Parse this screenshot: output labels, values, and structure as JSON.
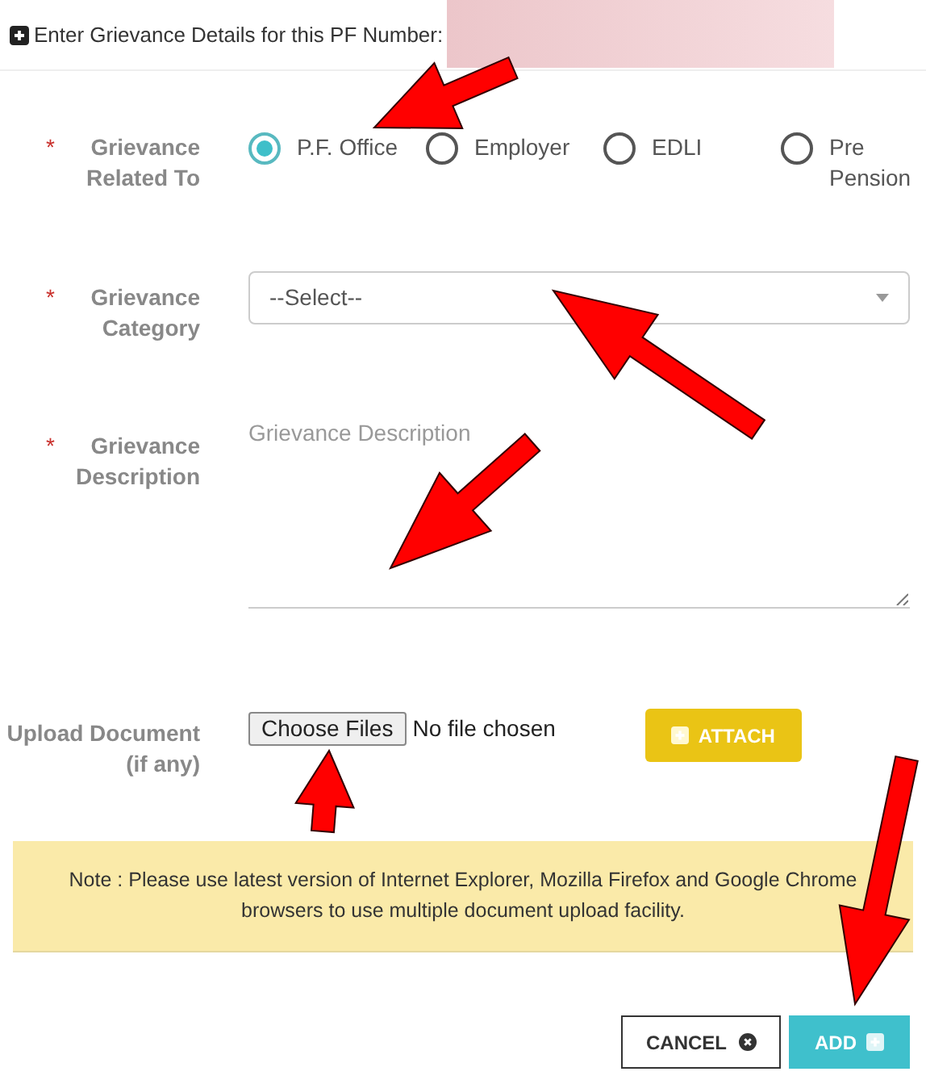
{
  "header": {
    "text": "Enter Grievance Details for this PF Number:",
    "redacted": true
  },
  "related_to": {
    "marker": "*",
    "label": "Grievance Related To",
    "options": [
      {
        "label": "P.F. Office",
        "selected": true
      },
      {
        "label": "Employer",
        "selected": false
      },
      {
        "label": "EDLI",
        "selected": false
      },
      {
        "label": "Pre Pension",
        "selected": false
      }
    ]
  },
  "category": {
    "marker": "*",
    "label": "Grievance Category",
    "value": "--Select--"
  },
  "description": {
    "marker": "*",
    "label": "Grievance Description",
    "placeholder": "Grievance Description"
  },
  "upload": {
    "label": "Upload Document (if any)",
    "choose_button": "Choose Files",
    "file_status": "No file chosen",
    "attach_button": "ATTACH"
  },
  "note": "Note : Please use latest version of Internet Explorer, Mozilla Firefox and Google Chrome browsers to use multiple document upload facility.",
  "buttons": {
    "cancel": "CANCEL",
    "add": "ADD"
  }
}
